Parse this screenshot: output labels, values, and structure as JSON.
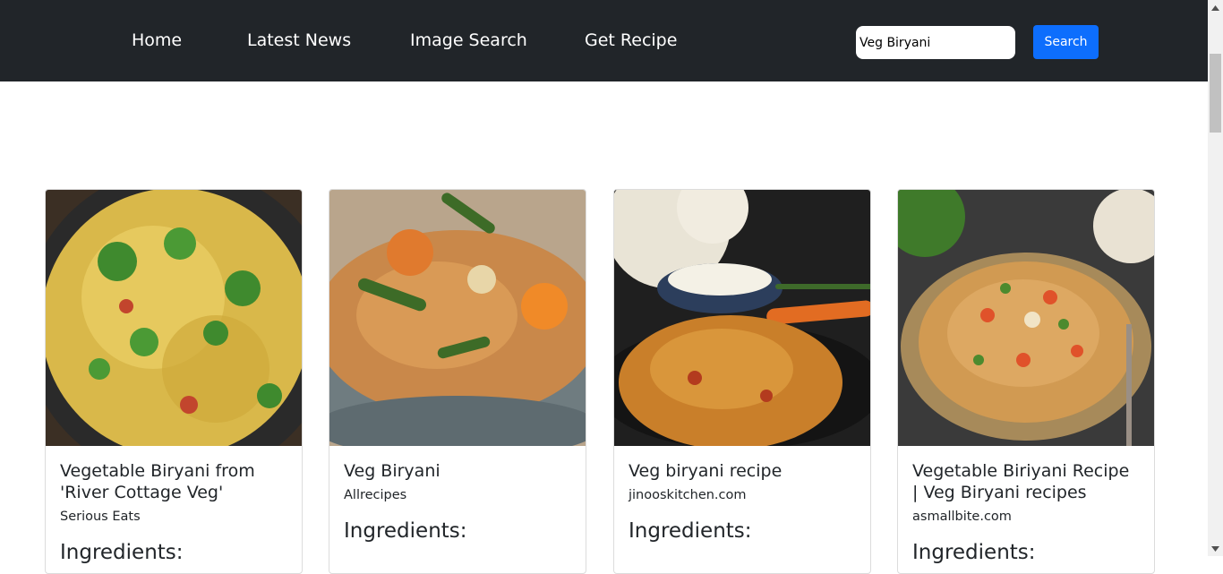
{
  "nav": {
    "links": [
      "Home",
      "Latest News",
      "Image Search",
      "Get Recipe"
    ]
  },
  "search": {
    "value": "Veg Biryani",
    "button_label": "Search"
  },
  "colors": {
    "navbar_bg": "#212529",
    "button_bg": "#0d6efd"
  },
  "cards": [
    {
      "title": "Vegetable Biryani from 'River Cottage Veg'",
      "source": "Serious Eats",
      "section": "Ingredients:"
    },
    {
      "title": "Veg Biryani",
      "source": "Allrecipes",
      "section": "Ingredients:"
    },
    {
      "title": "Veg biryani recipe",
      "source": "jinooskitchen.com",
      "section": "Ingredients:"
    },
    {
      "title": "Vegetable Biriyani Recipe | Veg Biryani recipes",
      "source": "asmallbite.com",
      "section": "Ingredients:"
    }
  ]
}
